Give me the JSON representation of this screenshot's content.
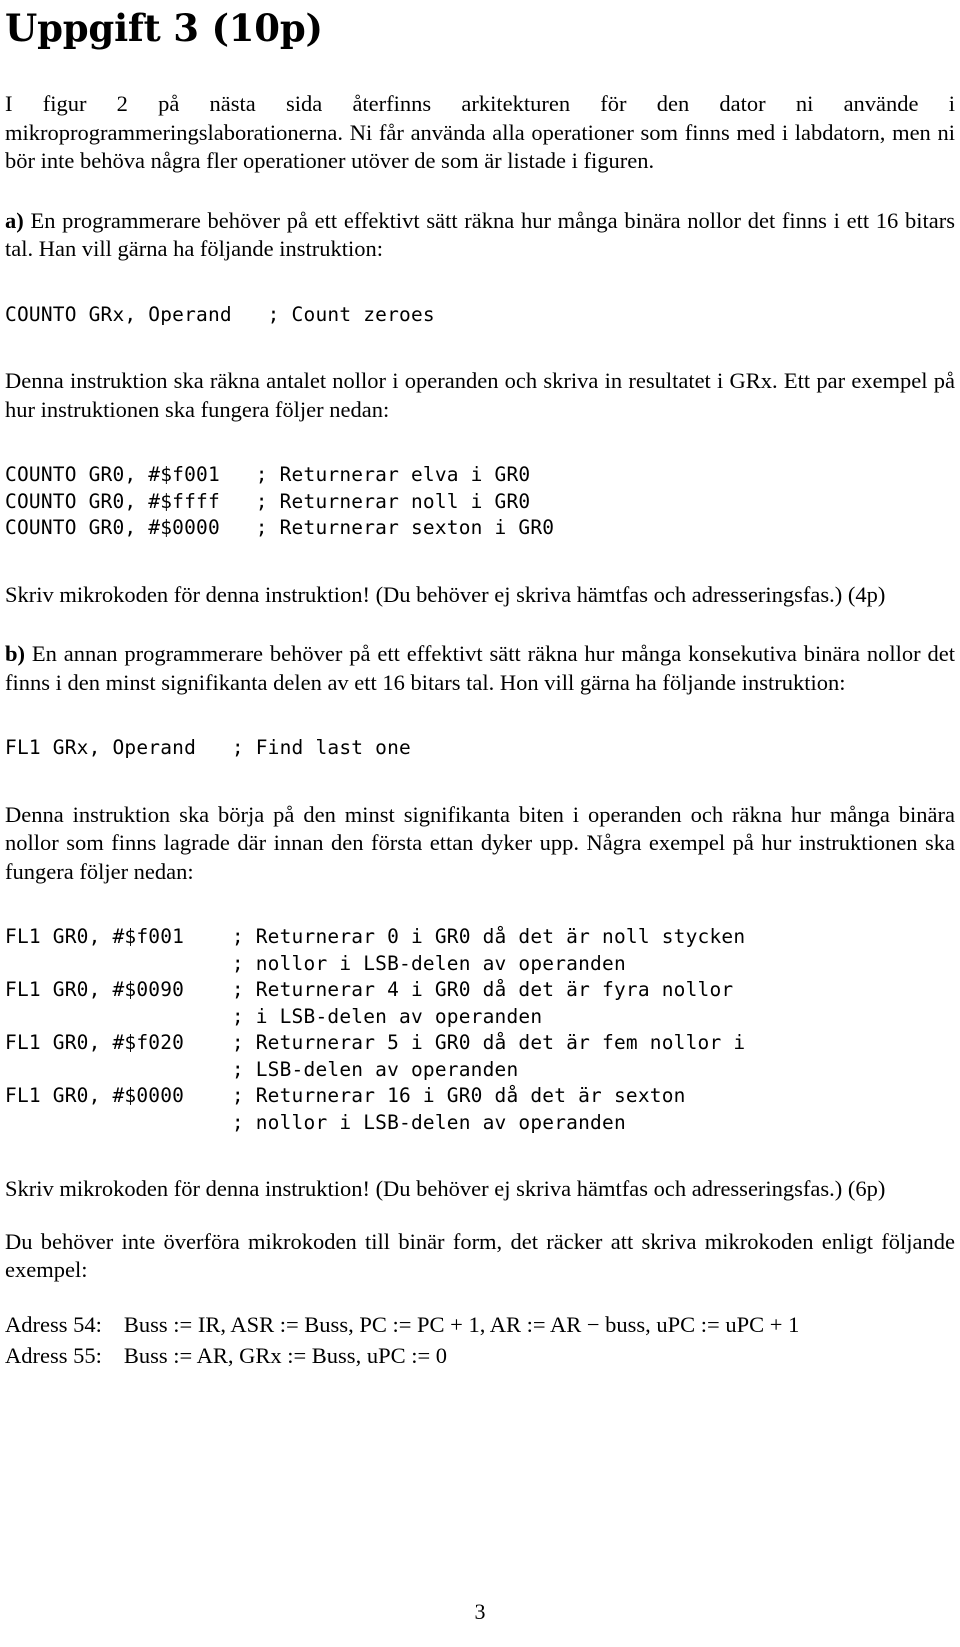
{
  "document": {
    "title": "Uppgift 3 (10p)",
    "page_number": "3",
    "intro_paragraph": "I figur 2 på nästa sida återfinns arkitekturen för den dator ni använde i mikroprogrammeringslaborationerna. Ni får använda alla operationer som finns med i labdatorn, men ni bör inte behöva några fler operationer utöver de som är listade i figuren.",
    "part_a": {
      "marker": "a)",
      "intro": " En programmerare behöver på ett effektivt sätt räkna hur många binära nollor det finns i ett 16 bitars tal. Han vill gärna ha följande instruktion:",
      "instruction_code": "COUNTO GRx, Operand   ; Count zeroes",
      "description": "Denna instruktion ska räkna antalet nollor i operanden och skriva in resultatet i GRx. Ett par exempel på hur instruktionen ska fungera följer nedan:",
      "examples_code": "COUNTO GR0, #$f001   ; Returnerar elva i GR0\nCOUNTO GR0, #$ffff   ; Returnerar noll i GR0\nCOUNTO GR0, #$0000   ; Returnerar sexton i GR0",
      "task": "Skriv mikrokoden för denna instruktion! (Du behöver ej skriva hämtfas och adresseringsfas.) (4p)"
    },
    "part_b": {
      "marker": "b)",
      "intro": " En annan programmerare behöver på ett effektivt sätt räkna hur många konsekutiva binära nollor det finns i den minst signifikanta delen av ett 16 bitars tal. Hon vill gärna ha följande instruktion:",
      "instruction_code": "FL1 GRx, Operand   ; Find last one",
      "description": "Denna instruktion ska börja på den minst signifikanta biten i operanden och räkna hur många binära nollor som finns lagrade där innan den första ettan dyker upp. Några exempel på hur instruktionen ska fungera följer nedan:",
      "examples_code": "FL1 GR0, #$f001    ; Returnerar 0 i GR0 då det är noll stycken\n                   ; nollor i LSB-delen av operanden\nFL1 GR0, #$0090    ; Returnerar 4 i GR0 då det är fyra nollor\n                   ; i LSB-delen av operanden\nFL1 GR0, #$f020    ; Returnerar 5 i GR0 då det är fem nollor i\n                   ; LSB-delen av operanden\nFL1 GR0, #$0000    ; Returnerar 16 i GR0 då det är sexton\n                   ; nollor i LSB-delen av operanden",
      "task": "Skriv mikrokoden för denna instruktion! (Du behöver ej skriva hämtfas och adresseringsfas.) (6p)"
    },
    "closing": {
      "note": "Du behöver inte överföra mikrokoden till binär form, det räcker att skriva mikrokoden enligt följande exempel:",
      "microcode_rows": [
        {
          "address_label": "Adress 54:",
          "operations": "Buss := IR, ASR := Buss, PC := PC + 1, AR := AR − buss, uPC := uPC + 1"
        },
        {
          "address_label": "Adress 55:",
          "operations": "Buss := AR, GRx := Buss, uPC := 0"
        }
      ]
    }
  }
}
